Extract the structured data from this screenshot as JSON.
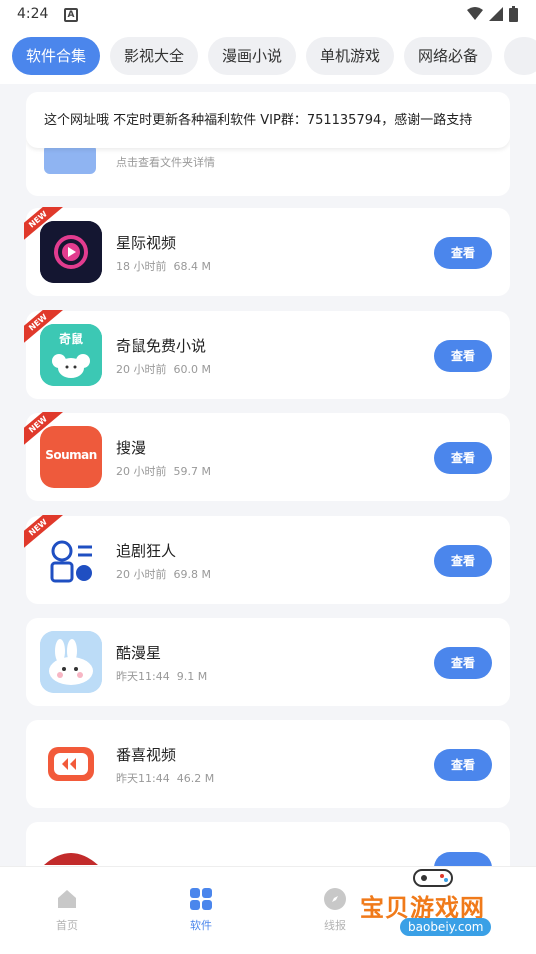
{
  "status": {
    "time": "4:24"
  },
  "tabs": [
    {
      "label": "软件合集",
      "active": true
    },
    {
      "label": "影视大全"
    },
    {
      "label": "漫画小说"
    },
    {
      "label": "单机游戏"
    },
    {
      "label": "网络必备"
    }
  ],
  "notice": {
    "text": "这个网址哦 不定时更新各种福利软件 VIP群：751135794，感谢一路支持",
    "folder_sub": "点击查看文件夹详情"
  },
  "apps": [
    {
      "name": "星际视频",
      "time": "18 小时前",
      "size": "68.4 M",
      "button": "查看",
      "badge": "NEW"
    },
    {
      "name": "奇鼠免费小说",
      "time": "20 小时前",
      "size": "60.0 M",
      "button": "查看",
      "badge": "NEW",
      "icon_text": "奇鼠"
    },
    {
      "name": "搜漫",
      "time": "20 小时前",
      "size": "59.7 M",
      "button": "查看",
      "badge": "NEW",
      "icon_text": "Souman"
    },
    {
      "name": "追剧狂人",
      "time": "20 小时前",
      "size": "69.8 M",
      "button": "查看",
      "badge": "NEW"
    },
    {
      "name": "酷漫星",
      "time": "昨天11:44",
      "size": "9.1 M",
      "button": "查看"
    },
    {
      "name": "番喜视频",
      "time": "昨天11:44",
      "size": "46.2 M",
      "button": "查看"
    }
  ],
  "bottom_nav": [
    {
      "label": "首页"
    },
    {
      "label": "软件",
      "active": true
    },
    {
      "label": "线报"
    }
  ],
  "watermark": {
    "main": "宝贝游戏网",
    "sub": "baobeiy.com"
  },
  "colors": {
    "accent": "#4b86ec",
    "badge": "#e0392b"
  }
}
